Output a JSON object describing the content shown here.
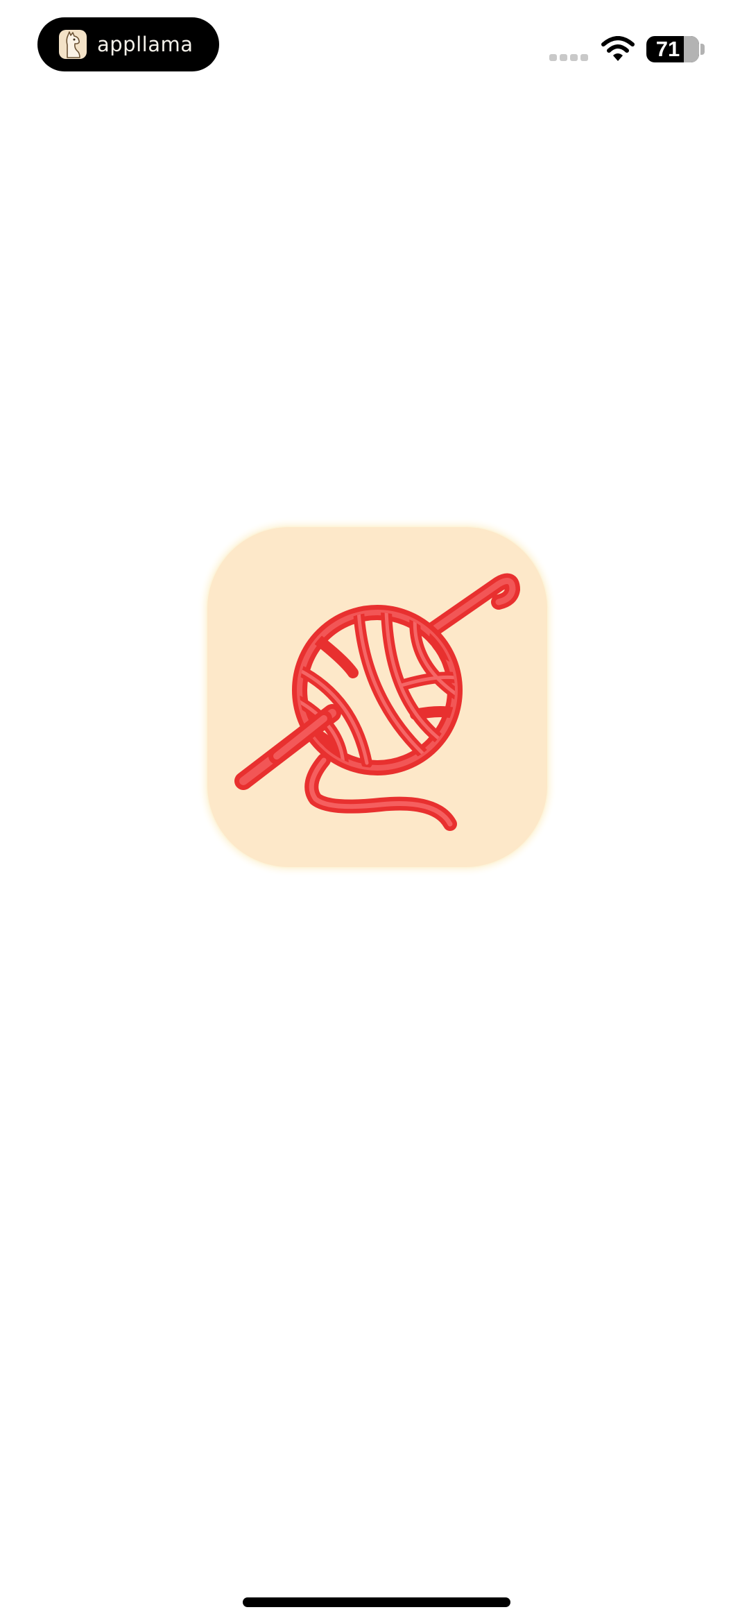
{
  "status_bar": {
    "pill_text": "appllama",
    "battery_level": "71",
    "battery_fraction": 0.71
  },
  "icons": {
    "pill_logo": "llama-logo-icon",
    "signal": "cellular-signal-icon",
    "wifi": "wifi-icon",
    "battery": "battery-icon",
    "app": "yarn-ball-crochet-hook-icon"
  },
  "colors": {
    "icon_background": "#fde8c9",
    "yarn": "#f03a3a",
    "page_background": "#ffffff"
  }
}
